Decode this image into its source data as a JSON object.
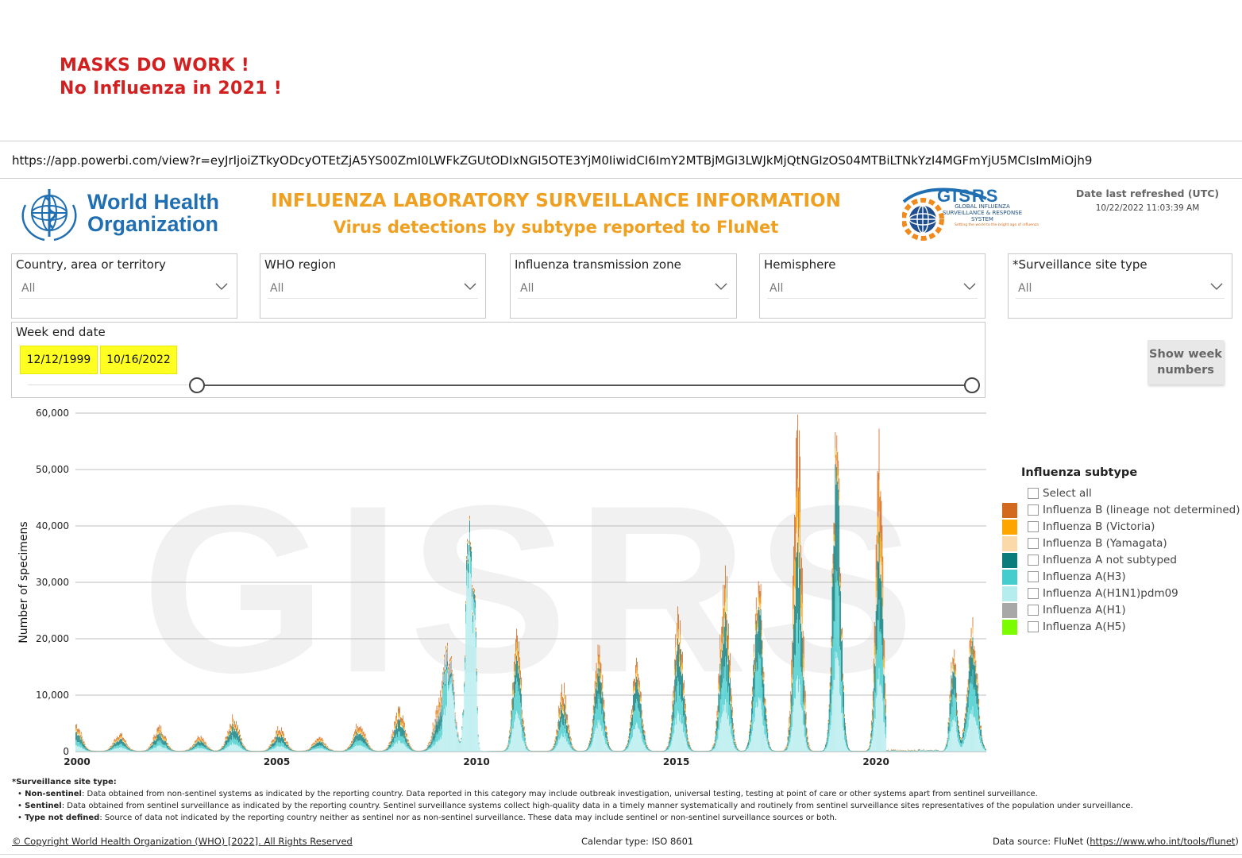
{
  "headline": {
    "line1": "MASKS DO WORK !",
    "line2": "No Influenza in 2021 !"
  },
  "url": "https://app.powerbi.com/view?r=eyJrIjoiZTkyODcyOTEtZjA5YS00ZmI0LWFkZGUtODIxNGI5OTE3YjM0IiwidCI6ImY2MTBjMGI3LWJkMjQtNGIzOS04MTBiLTNkYzI4MGFmYjU5MCIsImMiOjh9",
  "who": {
    "line1": "World Health",
    "line2": "Organization"
  },
  "title": {
    "line1": "INFLUENZA LABORATORY SURVEILLANCE INFORMATION",
    "line2": "Virus detections by subtype reported to FluNet"
  },
  "gisrs": {
    "name": "GISRS",
    "sub": "GLOBAL INFLUENZA SURVEILLANCE & RESPONSE SYSTEM",
    "tag": "Setting the world to the bright age of influenza"
  },
  "refresh": {
    "label": "Date last refreshed (UTC)",
    "value": "10/22/2022 11:03:39 AM"
  },
  "filters": [
    {
      "label": "Country, area or territory",
      "value": "All"
    },
    {
      "label": "WHO region",
      "value": "All"
    },
    {
      "label": "Influenza transmission zone",
      "value": "All"
    },
    {
      "label": "Hemisphere",
      "value": "All"
    },
    {
      "label": "*Surveillance site type",
      "value": "All"
    }
  ],
  "week": {
    "label": "Week end date",
    "start": "12/12/1999",
    "end": "10/16/2022"
  },
  "show_week_button": {
    "line1": "Show week",
    "line2": "numbers"
  },
  "legend": {
    "title": "Influenza subtype",
    "select_all": "Select all",
    "items": [
      {
        "label": "Influenza B (lineage not determined)",
        "color": "#d2691e"
      },
      {
        "label": "Influenza B (Victoria)",
        "color": "#ffa500"
      },
      {
        "label": "Influenza B (Yamagata)",
        "color": "#fbd9a8"
      },
      {
        "label": "Influenza A not subtyped",
        "color": "#0a7c7c"
      },
      {
        "label": "Influenza A(H3)",
        "color": "#45cdcd"
      },
      {
        "label": "Influenza A(H1N1)pdm09",
        "color": "#b5ecee"
      },
      {
        "label": "Influenza A(H1)",
        "color": "#a8a8a8"
      },
      {
        "label": "Influenza A(H5)",
        "color": "#7cfc00"
      }
    ]
  },
  "watermark": "GISRS",
  "chart_data": {
    "type": "bar",
    "stacked": true,
    "ylabel": "Number of specimens",
    "xlabel": "",
    "ylim": [
      0,
      60000
    ],
    "yticks": [
      0,
      10000,
      20000,
      30000,
      40000,
      50000,
      60000
    ],
    "ytick_labels": [
      "0",
      "10,000",
      "20,000",
      "30,000",
      "40,000",
      "50,000",
      "60,000"
    ],
    "xticks": [
      2000,
      2005,
      2010,
      2015,
      2020
    ],
    "xlim": [
      2000.0,
      2022.8
    ],
    "grid": true,
    "legend_position": "right",
    "peaks": [
      {
        "t": 2000.0,
        "h": 4800,
        "w": 0.14,
        "a": 0.5,
        "b": 0.28
      },
      {
        "t": 2001.1,
        "h": 3000,
        "w": 0.14,
        "a": 0.45,
        "b": 0.3
      },
      {
        "t": 2002.1,
        "h": 4200,
        "w": 0.14,
        "a": 0.45,
        "b": 0.3
      },
      {
        "t": 2003.1,
        "h": 2500,
        "w": 0.14,
        "a": 0.45,
        "b": 0.3
      },
      {
        "t": 2003.95,
        "h": 5800,
        "w": 0.14,
        "a": 0.5,
        "b": 0.25
      },
      {
        "t": 2005.1,
        "h": 4000,
        "w": 0.14,
        "a": 0.45,
        "b": 0.3
      },
      {
        "t": 2006.1,
        "h": 2500,
        "w": 0.14,
        "a": 0.45,
        "b": 0.3
      },
      {
        "t": 2007.1,
        "h": 5000,
        "w": 0.14,
        "a": 0.45,
        "b": 0.28
      },
      {
        "t": 2008.1,
        "h": 7000,
        "w": 0.14,
        "a": 0.45,
        "b": 0.28
      },
      {
        "t": 2009.1,
        "h": 7000,
        "w": 0.14,
        "a": 0.45,
        "b": 0.25
      },
      {
        "t": 2009.35,
        "h": 14000,
        "w": 0.12,
        "a": 0.05,
        "b": 0.05
      },
      {
        "t": 2009.85,
        "h": 40500,
        "w": 0.08,
        "a": 0.03,
        "b": 0.02
      },
      {
        "t": 2010.0,
        "h": 18000,
        "w": 0.04,
        "a": 0.05,
        "b": 0.03
      },
      {
        "t": 2011.05,
        "h": 19500,
        "w": 0.1,
        "a": 0.3,
        "b": 0.22
      },
      {
        "t": 2012.2,
        "h": 11000,
        "w": 0.11,
        "a": 0.35,
        "b": 0.3
      },
      {
        "t": 2013.1,
        "h": 17500,
        "w": 0.11,
        "a": 0.4,
        "b": 0.22
      },
      {
        "t": 2014.05,
        "h": 16000,
        "w": 0.11,
        "a": 0.4,
        "b": 0.2
      },
      {
        "t": 2015.1,
        "h": 24000,
        "w": 0.11,
        "a": 0.45,
        "b": 0.22
      },
      {
        "t": 2016.25,
        "h": 32000,
        "w": 0.11,
        "a": 0.4,
        "b": 0.25
      },
      {
        "t": 2017.1,
        "h": 30000,
        "w": 0.11,
        "a": 0.45,
        "b": 0.15
      },
      {
        "t": 2018.08,
        "h": 56500,
        "w": 0.1,
        "a": 0.35,
        "b": 0.38
      },
      {
        "t": 2019.05,
        "h": 52500,
        "w": 0.1,
        "a": 0.55,
        "b": 0.1
      },
      {
        "t": 2020.12,
        "h": 51500,
        "w": 0.09,
        "a": 0.35,
        "b": 0.32
      },
      {
        "t": 2021.98,
        "h": 18000,
        "w": 0.08,
        "a": 0.4,
        "b": 0.15
      },
      {
        "t": 2022.45,
        "h": 22000,
        "w": 0.12,
        "a": 0.4,
        "b": 0.15
      }
    ]
  },
  "notes": {
    "title": "*Surveillance site type:",
    "items": [
      {
        "term": "Non-sentinel",
        "text": ": Data obtained from non-sentinel systems as indicated by the reporting country. Data reported in this category may include outbreak investigation, universal testing, testing at point of care or other systems apart from sentinel surveillance."
      },
      {
        "term": "Sentinel",
        "text": ": Data obtained from sentinel surveillance as indicated by the reporting country. Sentinel surveillance systems collect high-quality data in a timely manner systematically and routinely from sentinel surveillance sites representatives of the population under surveillance."
      },
      {
        "term": "Type not defined",
        "text": ": Source of data not indicated by the reporting country neither as sentinel nor as non-sentinel surveillance. These data may include sentinel or non-sentinel surveillance sources or both."
      }
    ]
  },
  "footer": {
    "copyright": "© Copyright World Health Organization (WHO) [2022]. All Rights Reserved",
    "calendar": "Calendar type: ISO 8601",
    "source_prefix": "Data source: FluNet (",
    "source_link": "https://www.who.int/tools/flunet",
    "source_suffix": ")"
  }
}
